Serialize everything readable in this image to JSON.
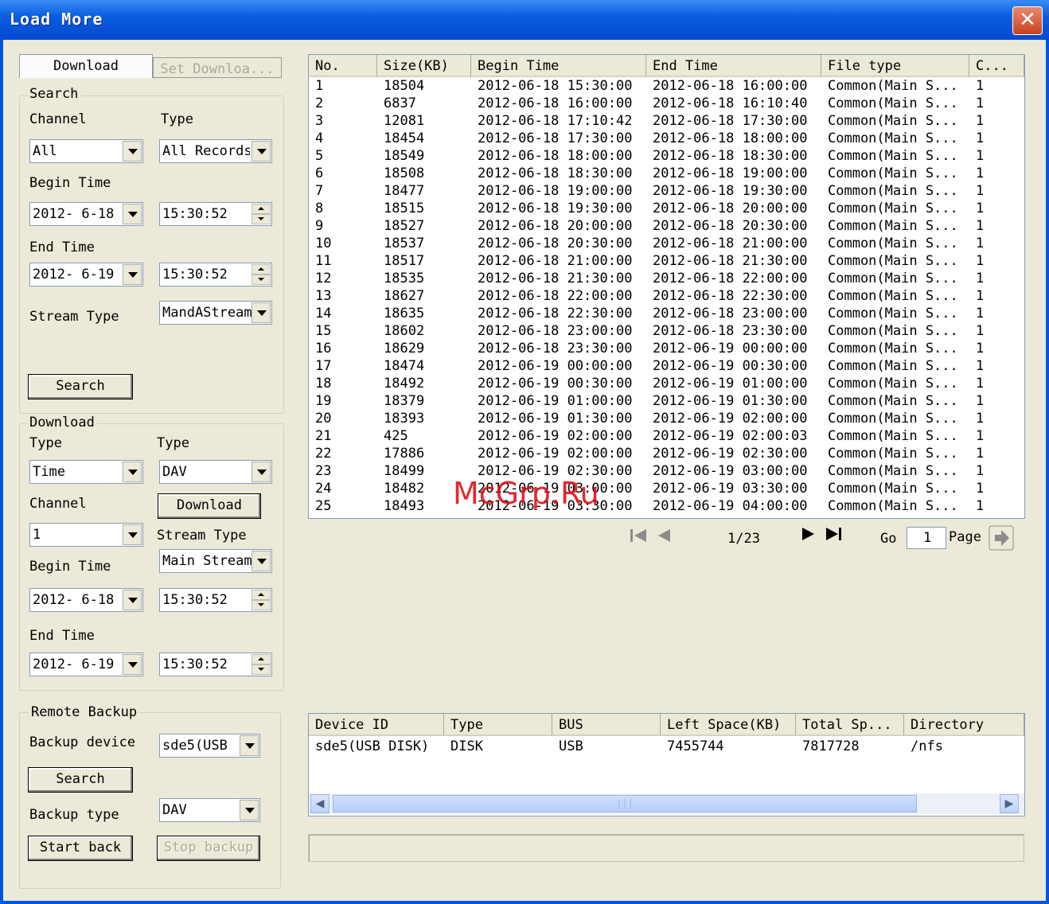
{
  "window": {
    "title": "Load More",
    "close_glyph": "✕"
  },
  "tabs": [
    "Download",
    "Set Downloa..."
  ],
  "search_group": {
    "title": "Search",
    "channel_label": "Channel",
    "type_label": "Type",
    "channel_value": "All",
    "type_value": "All Records",
    "begin_time_label": "Begin Time",
    "begin_date": "2012- 6-18",
    "begin_time": "15:30:52",
    "end_time_label": "End Time",
    "end_date": "2012- 6-19",
    "end_time": "15:30:52",
    "stream_type_label": "Stream Type",
    "stream_type_value": "MandAStream",
    "search_button": "Search"
  },
  "download_group": {
    "title": "Download",
    "type_label_1": "Type",
    "type_label_2": "Type",
    "type_value_1": "Time",
    "type_value_2": "DAV",
    "channel_label": "Channel",
    "download_button": "Download",
    "channel_value": "1",
    "stream_type_label": "Stream Type",
    "stream_type_value": "Main Stream",
    "begin_time_label": "Begin Time",
    "begin_date": "2012- 6-18",
    "begin_time": "15:30:52",
    "end_time_label": "End Time",
    "end_date": "2012- 6-19",
    "end_time": "15:30:52"
  },
  "remote_backup_group": {
    "title": "Remote Backup",
    "backup_device_label": "Backup device",
    "backup_device_value": "sde5(USB",
    "search_button": "Search",
    "backup_type_label": "Backup type",
    "backup_type_value": "DAV",
    "start_button": "Start back",
    "stop_button": "Stop backup"
  },
  "file_table": {
    "headers": [
      "No.",
      "Size(KB)",
      "Begin Time",
      "End Time",
      "File type",
      "C..."
    ],
    "rows": [
      [
        "1",
        "18504",
        "2012-06-18 15:30:00",
        "2012-06-18 16:00:00",
        "Common(Main S...",
        "1"
      ],
      [
        "2",
        "6837",
        "2012-06-18 16:00:00",
        "2012-06-18 16:10:40",
        "Common(Main S...",
        "1"
      ],
      [
        "3",
        "12081",
        "2012-06-18 17:10:42",
        "2012-06-18 17:30:00",
        "Common(Main S...",
        "1"
      ],
      [
        "4",
        "18454",
        "2012-06-18 17:30:00",
        "2012-06-18 18:00:00",
        "Common(Main S...",
        "1"
      ],
      [
        "5",
        "18549",
        "2012-06-18 18:00:00",
        "2012-06-18 18:30:00",
        "Common(Main S...",
        "1"
      ],
      [
        "6",
        "18508",
        "2012-06-18 18:30:00",
        "2012-06-18 19:00:00",
        "Common(Main S...",
        "1"
      ],
      [
        "7",
        "18477",
        "2012-06-18 19:00:00",
        "2012-06-18 19:30:00",
        "Common(Main S...",
        "1"
      ],
      [
        "8",
        "18515",
        "2012-06-18 19:30:00",
        "2012-06-18 20:00:00",
        "Common(Main S...",
        "1"
      ],
      [
        "9",
        "18527",
        "2012-06-18 20:00:00",
        "2012-06-18 20:30:00",
        "Common(Main S...",
        "1"
      ],
      [
        "10",
        "18537",
        "2012-06-18 20:30:00",
        "2012-06-18 21:00:00",
        "Common(Main S...",
        "1"
      ],
      [
        "11",
        "18517",
        "2012-06-18 21:00:00",
        "2012-06-18 21:30:00",
        "Common(Main S...",
        "1"
      ],
      [
        "12",
        "18535",
        "2012-06-18 21:30:00",
        "2012-06-18 22:00:00",
        "Common(Main S...",
        "1"
      ],
      [
        "13",
        "18627",
        "2012-06-18 22:00:00",
        "2012-06-18 22:30:00",
        "Common(Main S...",
        "1"
      ],
      [
        "14",
        "18635",
        "2012-06-18 22:30:00",
        "2012-06-18 23:00:00",
        "Common(Main S...",
        "1"
      ],
      [
        "15",
        "18602",
        "2012-06-18 23:00:00",
        "2012-06-18 23:30:00",
        "Common(Main S...",
        "1"
      ],
      [
        "16",
        "18629",
        "2012-06-18 23:30:00",
        "2012-06-19 00:00:00",
        "Common(Main S...",
        "1"
      ],
      [
        "17",
        "18474",
        "2012-06-19 00:00:00",
        "2012-06-19 00:30:00",
        "Common(Main S...",
        "1"
      ],
      [
        "18",
        "18492",
        "2012-06-19 00:30:00",
        "2012-06-19 01:00:00",
        "Common(Main S...",
        "1"
      ],
      [
        "19",
        "18379",
        "2012-06-19 01:00:00",
        "2012-06-19 01:30:00",
        "Common(Main S...",
        "1"
      ],
      [
        "20",
        "18393",
        "2012-06-19 01:30:00",
        "2012-06-19 02:00:00",
        "Common(Main S...",
        "1"
      ],
      [
        "21",
        "425",
        "2012-06-19 02:00:00",
        "2012-06-19 02:00:03",
        "Common(Main S...",
        "1"
      ],
      [
        "22",
        "17886",
        "2012-06-19 02:00:00",
        "2012-06-19 02:30:00",
        "Common(Main S...",
        "1"
      ],
      [
        "23",
        "18499",
        "2012-06-19 02:30:00",
        "2012-06-19 03:00:00",
        "Common(Main S...",
        "1"
      ],
      [
        "24",
        "18482",
        "2012-06-19 03:00:00",
        "2012-06-19 03:30:00",
        "Common(Main S...",
        "1"
      ],
      [
        "25",
        "18493",
        "2012-06-19 03:30:00",
        "2012-06-19 04:00:00",
        "Common(Main S...",
        "1"
      ]
    ]
  },
  "pager": {
    "page_indicator": "1/23",
    "go_label": "Go",
    "go_value": "1",
    "page_label": "Page",
    "icons": [
      "first-page-icon",
      "prev-page-icon",
      "next-page-icon",
      "last-page-icon",
      "go-arrow-icon"
    ]
  },
  "device_table": {
    "headers": [
      "Device ID",
      "Type",
      "BUS",
      "Left Space(KB)",
      "Total Sp...",
      "Directory"
    ],
    "rows": [
      [
        "sde5(USB DISK)",
        "DISK",
        "USB",
        "7455744",
        "7817728",
        "/nfs"
      ]
    ],
    "scroll_thumb_glyph": "|||"
  },
  "watermark": "McGrp.Ru"
}
